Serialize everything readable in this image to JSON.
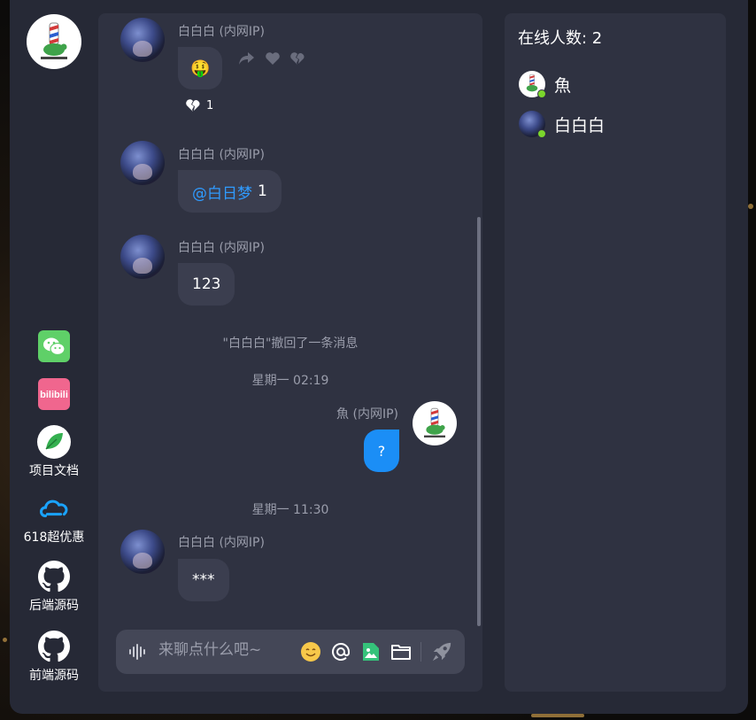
{
  "sidebar": {
    "links": [
      {
        "name": "wechat",
        "label": ""
      },
      {
        "name": "bilibili",
        "label": ""
      },
      {
        "name": "docs",
        "label": "项目文档"
      },
      {
        "name": "cloud",
        "label": "618超优惠"
      },
      {
        "name": "backend",
        "label": "后端源码"
      },
      {
        "name": "frontend",
        "label": "前端源码"
      }
    ]
  },
  "chat": {
    "messages": [
      {
        "sender": "白白白 (内网IP)",
        "type": "emoji",
        "content": "🤑",
        "reaction_count": "1"
      },
      {
        "sender": "白白白 (内网IP)",
        "type": "text",
        "mention": "@白日梦",
        "content": "1"
      },
      {
        "sender": "白白白 (内网IP)",
        "type": "text",
        "content": "123"
      },
      {
        "sender": "白白白 (内网IP)",
        "type": "text",
        "content": "***"
      }
    ],
    "system_recall": "\"白白白\"撤回了一条消息",
    "time1": "星期一 02:19",
    "time2": "星期一 11:30",
    "my_message": {
      "sender": "魚 (内网IP)",
      "content": "?"
    }
  },
  "composer": {
    "placeholder": "来聊点什么吧~"
  },
  "online": {
    "title": "在线人数: 2",
    "users": [
      {
        "name": "魚"
      },
      {
        "name": "白白白"
      }
    ]
  },
  "colors": {
    "accent": "#1b8ef6",
    "mention": "#2f9bff",
    "online_dot": "#7bd62c",
    "panel": "#2f3241",
    "window": "#262936"
  }
}
